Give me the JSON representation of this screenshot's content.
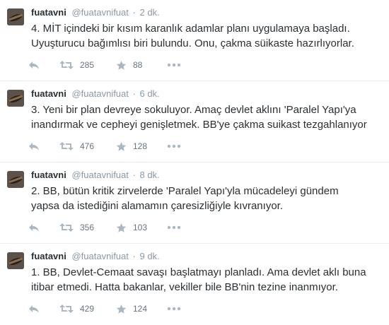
{
  "tweets": [
    {
      "fullname": "fuatavni",
      "username": "@fuatavnifuat",
      "separator": "·",
      "time": "2 dk.",
      "lines": [
        "4. MİT içindeki bir kısım karanlık adamlar planı uygulamaya başladı.",
        "Uyuşturucu bağımlısı biri bulundu. Onu, çakma süikaste hazırlıyorlar."
      ],
      "retweets": "285",
      "favorites": "88"
    },
    {
      "fullname": "fuatavni",
      "username": "@fuatavnifuat",
      "separator": "·",
      "time": "6 dk.",
      "lines": [
        "3. Yeni bir plan devreye sokuluyor. Amaç devlet aklını 'Paralel Yapı'ya",
        "inandırmak ve cepheyi genişletmek. BB'ye çakma suikast tezgahlanıyor"
      ],
      "retweets": "476",
      "favorites": "128"
    },
    {
      "fullname": "fuatavni",
      "username": "@fuatavnifuat",
      "separator": "·",
      "time": "8 dk.",
      "lines": [
        "2. BB, bütün kritik zirvelerde 'Paralel Yapı'yla mücadeleyi gündem",
        "yapsa da istediğini alamamın çaresizliğiyle kıvranıyor."
      ],
      "retweets": "356",
      "favorites": "103"
    },
    {
      "fullname": "fuatavni",
      "username": "@fuatavnifuat",
      "separator": "·",
      "time": "9 dk.",
      "lines": [
        "1. BB, Devlet-Cemaat savaşı başlatmayı planladı. Ama devlet aklı buna",
        "itibar etmedi. Hatta bakanlar, vekiller bile BB'nin tezine inanmıyor."
      ],
      "retweets": "429",
      "favorites": "124"
    }
  ],
  "icons": {
    "reply": "reply-icon",
    "retweet": "retweet-icon",
    "favorite": "star-icon",
    "more": "more-dots-icon"
  },
  "colors": {
    "text": "#292f33",
    "meta": "#8899a6",
    "action_icon": "#aab8c2",
    "divider": "#e6ecf0"
  }
}
